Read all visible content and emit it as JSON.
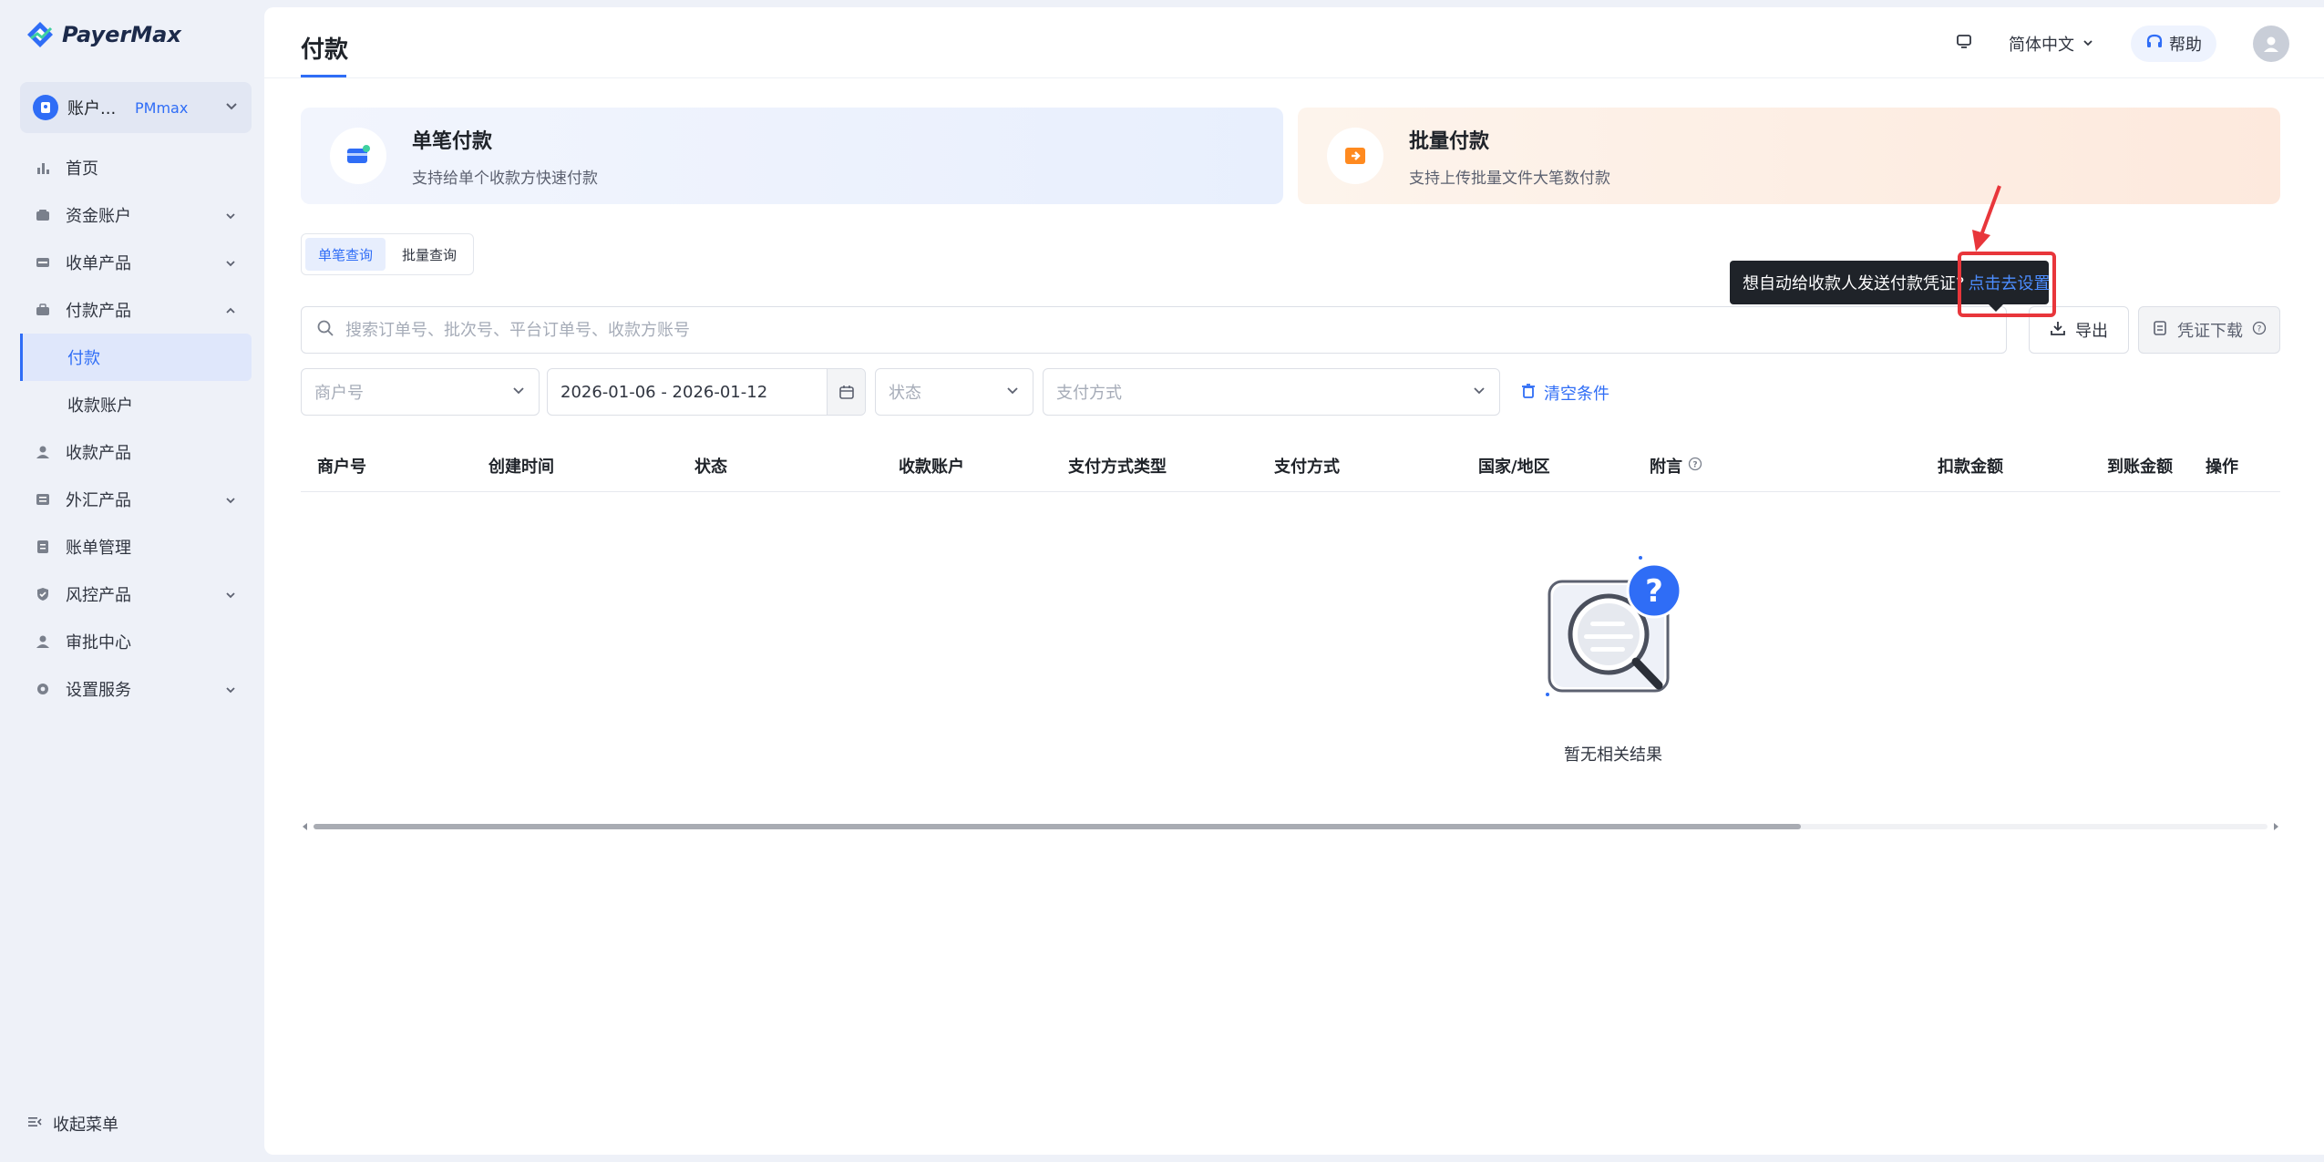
{
  "brand": {
    "name": "PayerMax",
    "accent": "#2f6df6",
    "danger": "#e8363b"
  },
  "account": {
    "name": "账户...",
    "badge": "PMmax"
  },
  "sidebar": {
    "items": [
      {
        "label": "首页",
        "icon": "bar-chart-icon"
      },
      {
        "label": "资金账户",
        "icon": "wallet-icon"
      },
      {
        "label": "收单产品",
        "icon": "card-icon"
      },
      {
        "label": "付款产品",
        "icon": "briefcase-icon"
      },
      {
        "label": "付款",
        "sub": true,
        "active": true
      },
      {
        "label": "收款账户",
        "sub": true
      },
      {
        "label": "收款产品",
        "icon": "user-icon"
      },
      {
        "label": "外汇产品",
        "icon": "exchange-icon"
      },
      {
        "label": "账单管理",
        "icon": "bill-icon"
      },
      {
        "label": "风控产品",
        "icon": "shield-icon"
      },
      {
        "label": "审批中心",
        "icon": "user-check-icon"
      },
      {
        "label": "设置服务",
        "icon": "gear-icon"
      }
    ],
    "collapse_label": "收起菜单"
  },
  "header": {
    "title": "付款",
    "language": "简体中文",
    "help": "帮助"
  },
  "cards": {
    "single": {
      "title": "单笔付款",
      "desc": "支持给单个收款方快速付款"
    },
    "batch": {
      "title": "批量付款",
      "desc": "支持上传批量文件大笔数付款"
    }
  },
  "query_tabs": [
    "单笔查询",
    "批量查询"
  ],
  "search": {
    "placeholder": "搜索订单号、批次号、平台订单号、收款方账号"
  },
  "toolbar": {
    "export": "导出",
    "voucher": "凭证下载"
  },
  "tooltip": {
    "text": "想自动给收款人发送付款凭证?",
    "link": "点击去设置"
  },
  "filters": {
    "merchant_placeholder": "商户号",
    "date_range": "2026-01-06 - 2026-01-12",
    "status_placeholder": "状态",
    "method_placeholder": "支付方式",
    "clear": "清空条件"
  },
  "table": {
    "columns": [
      "商户号",
      "创建时间",
      "状态",
      "收款账户",
      "支付方式类型",
      "支付方式",
      "国家/地区",
      "附言",
      "扣款金额",
      "到账金额",
      "操作"
    ]
  },
  "empty_state": {
    "text": "暂无相关结果"
  }
}
